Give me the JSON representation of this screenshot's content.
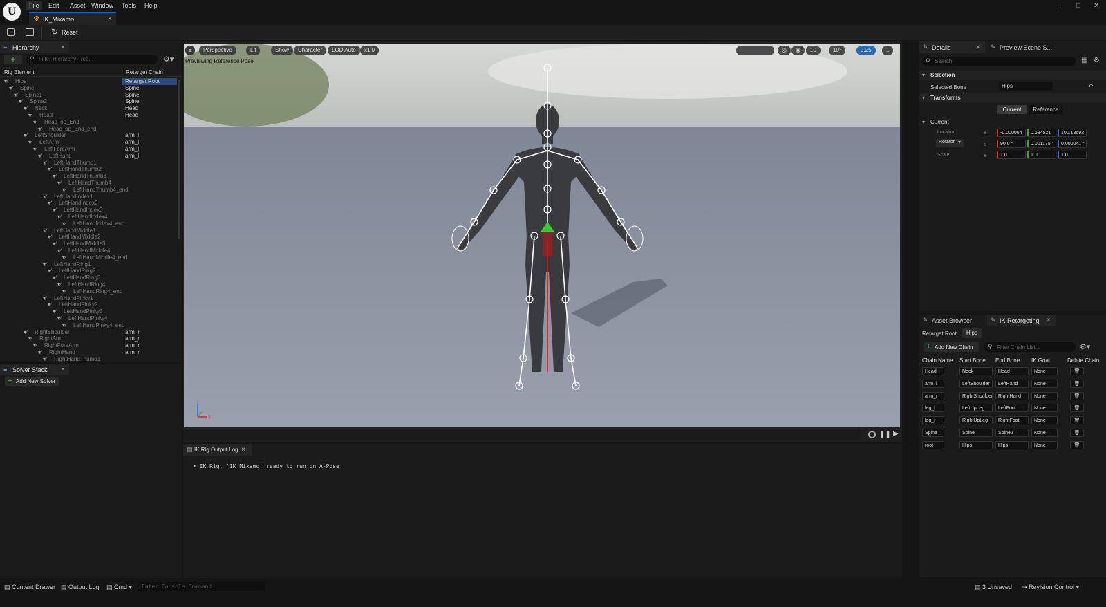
{
  "app": {
    "logo": "U"
  },
  "menu": [
    "File",
    "Edit",
    "Asset",
    "Window",
    "Tools",
    "Help"
  ],
  "window_controls": {
    "minimize": "–",
    "restore": "□",
    "close": "✕"
  },
  "doc_tab": {
    "title": "IK_Mixamo",
    "close": "×"
  },
  "toolbar": {
    "reset": "Reset"
  },
  "hierarchy": {
    "tab": "Hierarchy",
    "search_placeholder": "Filter Hierarchy Tree...",
    "col_rig": "Rig Element",
    "col_chain": "Retarget Chain",
    "rows": [
      {
        "name": "Hips",
        "chain": "Retarget Root",
        "indent": 0
      },
      {
        "name": "Spine",
        "chain": "Spine",
        "indent": 1
      },
      {
        "name": "Spine1",
        "chain": "Spine",
        "indent": 2
      },
      {
        "name": "Spine2",
        "chain": "Spine",
        "indent": 3
      },
      {
        "name": "Neck",
        "chain": "Head",
        "indent": 4
      },
      {
        "name": "Head",
        "chain": "Head",
        "indent": 5
      },
      {
        "name": "HeadTop_End",
        "chain": "",
        "indent": 6
      },
      {
        "name": "HeadTop_End_end",
        "chain": "",
        "indent": 7
      },
      {
        "name": "LeftShoulder",
        "chain": "arm_l",
        "indent": 4
      },
      {
        "name": "LeftArm",
        "chain": "arm_l",
        "indent": 5
      },
      {
        "name": "LeftForeArm",
        "chain": "arm_l",
        "indent": 6
      },
      {
        "name": "LeftHand",
        "chain": "arm_l",
        "indent": 7
      },
      {
        "name": "LeftHandThumb1",
        "chain": "",
        "indent": 8
      },
      {
        "name": "LeftHandThumb2",
        "chain": "",
        "indent": 9
      },
      {
        "name": "LeftHandThumb3",
        "chain": "",
        "indent": 10
      },
      {
        "name": "LeftHandThumb4",
        "chain": "",
        "indent": 11
      },
      {
        "name": "LeftHandThumb4_end",
        "chain": "",
        "indent": 12
      },
      {
        "name": "LeftHandIndex1",
        "chain": "",
        "indent": 8
      },
      {
        "name": "LeftHandIndex2",
        "chain": "",
        "indent": 9
      },
      {
        "name": "LeftHandIndex3",
        "chain": "",
        "indent": 10
      },
      {
        "name": "LeftHandIndex4",
        "chain": "",
        "indent": 11
      },
      {
        "name": "LeftHandIndex4_end",
        "chain": "",
        "indent": 12
      },
      {
        "name": "LeftHandMiddle1",
        "chain": "",
        "indent": 8
      },
      {
        "name": "LeftHandMiddle2",
        "chain": "",
        "indent": 9
      },
      {
        "name": "LeftHandMiddle3",
        "chain": "",
        "indent": 10
      },
      {
        "name": "LeftHandMiddle4",
        "chain": "",
        "indent": 11
      },
      {
        "name": "LeftHandMiddle4_end",
        "chain": "",
        "indent": 12
      },
      {
        "name": "LeftHandRing1",
        "chain": "",
        "indent": 8
      },
      {
        "name": "LeftHandRing2",
        "chain": "",
        "indent": 9
      },
      {
        "name": "LeftHandRing3",
        "chain": "",
        "indent": 10
      },
      {
        "name": "LeftHandRing4",
        "chain": "",
        "indent": 11
      },
      {
        "name": "LeftHandRing4_end",
        "chain": "",
        "indent": 12
      },
      {
        "name": "LeftHandPinky1",
        "chain": "",
        "indent": 8
      },
      {
        "name": "LeftHandPinky2",
        "chain": "",
        "indent": 9
      },
      {
        "name": "LeftHandPinky3",
        "chain": "",
        "indent": 10
      },
      {
        "name": "LeftHandPinky4",
        "chain": "",
        "indent": 11
      },
      {
        "name": "LeftHandPinky4_end",
        "chain": "",
        "indent": 12
      },
      {
        "name": "RightShoulder",
        "chain": "arm_r",
        "indent": 4
      },
      {
        "name": "RightArm",
        "chain": "arm_r",
        "indent": 5
      },
      {
        "name": "RightForeArm",
        "chain": "arm_r",
        "indent": 6
      },
      {
        "name": "RightHand",
        "chain": "arm_r",
        "indent": 7
      },
      {
        "name": "RightHandThumb1",
        "chain": "",
        "indent": 8
      }
    ]
  },
  "solver_stack": {
    "tab": "Solver Stack",
    "add": "Add New Solver"
  },
  "viewport": {
    "perspective": "Perspective",
    "lit": "Lit",
    "show": "Show",
    "character": "Character",
    "lod": "LOD Auto",
    "speed": "x1.0",
    "preview_label": "Previewing Reference Pose",
    "grid": "10",
    "angle": "10°",
    "scale": "0.25",
    "cam": "1",
    "axis_z": "z",
    "axis_x": "x"
  },
  "output_log": {
    "tab": "IK Rig Output Log",
    "line": "IK Rig, 'IK_Mixamo' ready to run on A-Pose."
  },
  "details": {
    "tab": "Details",
    "tab2": "Preview Scene S...",
    "search_placeholder": "Search",
    "selection": "Selection",
    "selected_bone_label": "Selected Bone",
    "selected_bone": "Hips",
    "transforms": "Transforms",
    "current_btn": "Current",
    "reference_btn": "Reference",
    "current_section": "Current",
    "location_label": "Location",
    "location": [
      "-0.000064",
      "0.634521",
      "100.18692"
    ],
    "rotator_label": "Rotator",
    "rotation": [
      "90.0 °",
      "0.001175 °",
      "0.000041 °"
    ],
    "scale_label": "Scale",
    "scale": [
      "1.0",
      "1.0",
      "1.0"
    ]
  },
  "retargeting": {
    "tab1": "Asset Browser",
    "tab2": "IK Retargeting",
    "root_label": "Retarget Root:",
    "root": "Hips",
    "add_chain": "Add New Chain",
    "filter_placeholder": "Filter Chain List...",
    "headers": [
      "Chain Name",
      "Start Bone",
      "End Bone",
      "IK Goal",
      "Delete Chain"
    ],
    "chains": [
      {
        "name": "Head",
        "start": "Neck",
        "end": "Head",
        "goal": "None"
      },
      {
        "name": "arm_l",
        "start": "LeftShoulder",
        "end": "LeftHand",
        "goal": "None"
      },
      {
        "name": "arm_r",
        "start": "RightShoulder",
        "end": "RightHand",
        "goal": "None"
      },
      {
        "name": "leg_l",
        "start": "LeftUpLeg",
        "end": "LeftFoot",
        "goal": "None"
      },
      {
        "name": "leg_r",
        "start": "RightUpLeg",
        "end": "RightFoot",
        "goal": "None"
      },
      {
        "name": "Spine",
        "start": "Spine",
        "end": "Spine2",
        "goal": "None"
      },
      {
        "name": "root",
        "start": "Hips",
        "end": "Hips",
        "goal": "None"
      }
    ]
  },
  "statusbar": {
    "content_drawer": "Content Drawer",
    "output_log": "Output Log",
    "cmd": "Cmd",
    "console_placeholder": "Enter Console Command",
    "unsaved": "3 Unsaved",
    "revision": "Revision Control"
  }
}
